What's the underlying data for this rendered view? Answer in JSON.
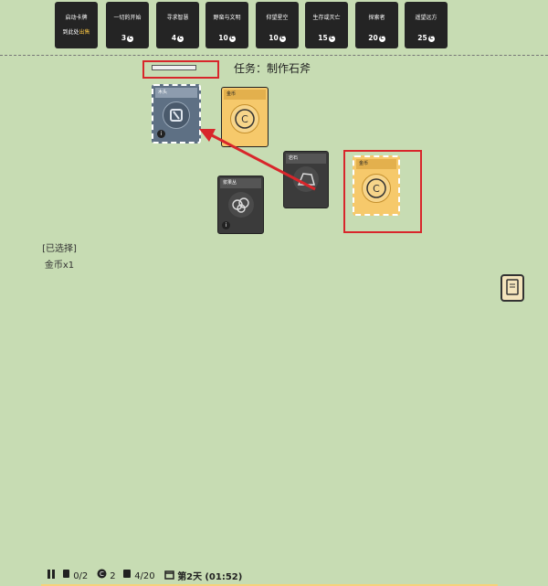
{
  "packs": [
    {
      "name": "启动卡牌",
      "line2": "到此处",
      "line2_highlight": "出售",
      "price": ""
    },
    {
      "name": "一切的开始",
      "price": "3"
    },
    {
      "name": "寻求智慧",
      "price": "4"
    },
    {
      "name": "野蛮与文明",
      "price": "10"
    },
    {
      "name": "仰望星空",
      "price": "10"
    },
    {
      "name": "生存或灭亡",
      "price": "15"
    },
    {
      "name": "探索者",
      "price": "20"
    },
    {
      "name": "遥望远方",
      "price": "25"
    }
  ],
  "task": {
    "label": "任务：制作石斧",
    "progress": 0.0
  },
  "cards": [
    {
      "id": "stick",
      "label": "木头",
      "info": "i"
    },
    {
      "id": "coin-top",
      "label": "金币"
    },
    {
      "id": "rock",
      "label": "岩石"
    },
    {
      "id": "berry-bush",
      "label": "浆果丛",
      "info": "i"
    },
    {
      "id": "coin-selected",
      "label": "金币"
    }
  ],
  "selection": {
    "title": "[已选择]",
    "item": "金币x1"
  },
  "status": {
    "food": "0/2",
    "coins": "2",
    "cards": "4/20",
    "day": "第2天",
    "time": "(01:52)"
  },
  "colors": {
    "highlight_red": "#d8262b",
    "coin_yellow": "#f6c96b",
    "board": "#c7dcb3"
  }
}
